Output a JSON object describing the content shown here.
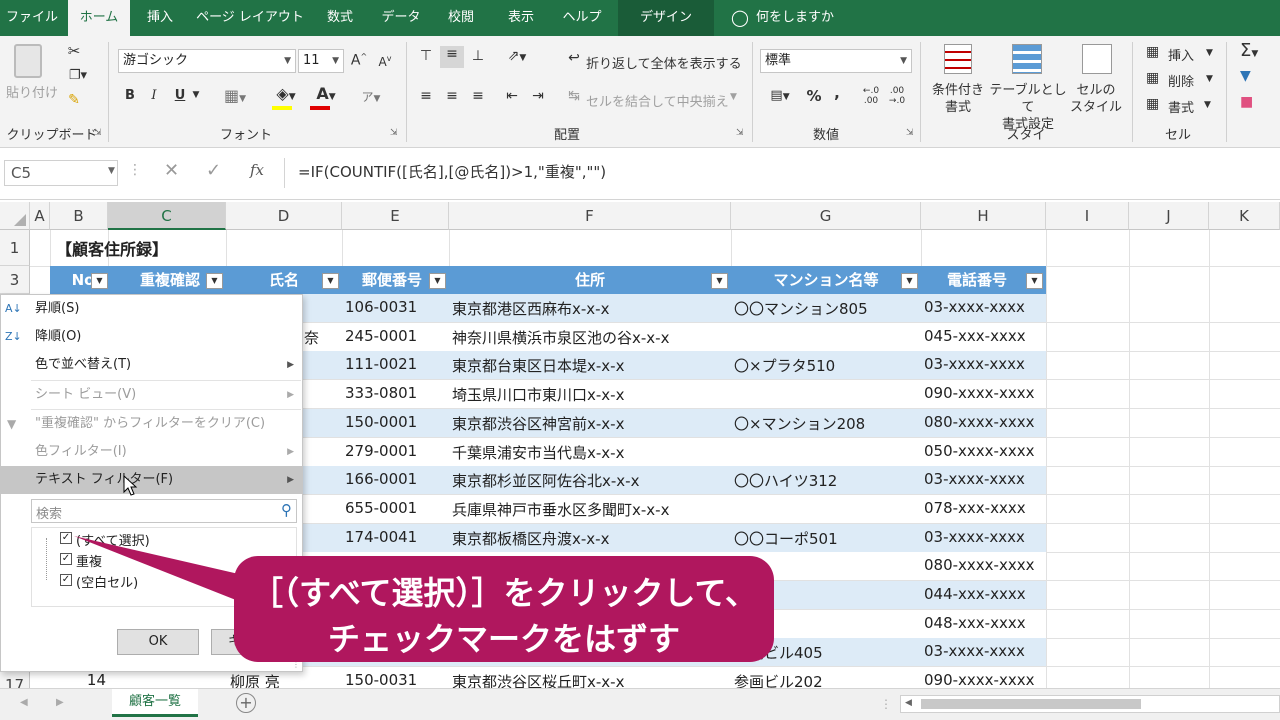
{
  "ribbon_tabs": [
    "ファイル",
    "ホーム",
    "挿入",
    "ページ レイアウト",
    "数式",
    "データ",
    "校閲",
    "表示",
    "ヘルプ",
    "デザイン",
    "何をしますか"
  ],
  "ribbon": {
    "paste": "貼り付け",
    "font_name": "游ゴシック",
    "font_size": "11",
    "bold": "B",
    "italic": "I",
    "underline": "U",
    "wrap_text": "折り返して全体を表示する",
    "merge_center": "セルを結合して中央揃え",
    "number_format": "標準",
    "conditional": "条件付き\n書式",
    "as_table": "テーブルとして\n書式設定",
    "cell_styles": "セルの\nスタイル",
    "insert": "挿入",
    "delete": "削除",
    "format": "書式",
    "groups": [
      "クリップボード",
      "フォント",
      "配置",
      "数値",
      "スタイル",
      "セル"
    ]
  },
  "formula_bar": {
    "name_box": "C5",
    "fx": "fx",
    "formula": "=IF(COUNTIF([氏名],[@氏名])>1,\"重複\",\"\")"
  },
  "columns": [
    "A",
    "B",
    "C",
    "D",
    "E",
    "F",
    "G",
    "H",
    "I",
    "J",
    "K"
  ],
  "row_numbers": [
    "1",
    "3",
    "17"
  ],
  "title_cell": "【顧客住所録】",
  "table_headers": [
    "No",
    "重複確認",
    "氏名",
    "郵便番号",
    "住所",
    "マンション名等",
    "電話番号"
  ],
  "rows": [
    {
      "zip": "106-0031",
      "addr": "東京都港区西麻布x-x-x",
      "bldg": "〇〇マンション805",
      "tel": "03-xxxx-xxxx"
    },
    {
      "zip": "245-0001",
      "addr": "神奈川県横浜市泉区池の谷x-x-x",
      "bldg": "",
      "tel": "045-xxx-xxxx",
      "name_frag": "奈"
    },
    {
      "zip": "111-0021",
      "addr": "東京都台東区日本堤x-x-x",
      "bldg": "〇×プラタ510",
      "tel": "03-xxxx-xxxx"
    },
    {
      "zip": "333-0801",
      "addr": "埼玉県川口市東川口x-x-x",
      "bldg": "",
      "tel": "090-xxxx-xxxx"
    },
    {
      "zip": "150-0001",
      "addr": "東京都渋谷区神宮前x-x-x",
      "bldg": "〇×マンション208",
      "tel": "080-xxxx-xxxx"
    },
    {
      "zip": "279-0001",
      "addr": "千葉県浦安市当代島x-x-x",
      "bldg": "",
      "tel": "050-xxxx-xxxx"
    },
    {
      "zip": "166-0001",
      "addr": "東京都杉並区阿佐谷北x-x-x",
      "bldg": "〇〇ハイツ312",
      "tel": "03-xxxx-xxxx"
    },
    {
      "zip": "655-0001",
      "addr": "兵庫県神戸市垂水区多聞町x-x-x",
      "bldg": "",
      "tel": "078-xxx-xxxx"
    },
    {
      "zip": "174-0041",
      "addr": "東京都板橋区舟渡x-x-x",
      "bldg": "〇〇コーポ501",
      "tel": "03-xxxx-xxxx"
    },
    {
      "zip": "",
      "addr": "",
      "bldg": "",
      "tel": "080-xxxx-xxxx"
    },
    {
      "zip": "",
      "addr": "",
      "bldg": "",
      "tel": "044-xxx-xxxx"
    },
    {
      "zip": "",
      "addr": "",
      "bldg": "",
      "tel": "048-xxx-xxxx"
    },
    {
      "zip": "",
      "addr": "",
      "bldg": "丸閣ビル405",
      "tel": "03-xxxx-xxxx"
    },
    {
      "zip": "150-0031",
      "addr": "東京都渋谷区桜丘町x-x-x",
      "bldg": "参画ビル202",
      "tel": "090-xxxx-xxxx",
      "no": "14",
      "name": "柳原 亮"
    }
  ],
  "filter_menu": {
    "sort_asc": "昇順(S)",
    "sort_desc": "降順(O)",
    "sort_color": "色で並べ替え(T)",
    "sheet_view": "シート ビュー(V)",
    "clear_filter": "\"重複確認\" からフィルターをクリア(C)",
    "color_filter": "色フィルター(I)",
    "text_filter": "テキスト フィルター(F)",
    "search_placeholder": "検索",
    "options": [
      "(すべて選択)",
      "重複",
      "(空白セル)"
    ],
    "ok": "OK",
    "cancel": "キャ"
  },
  "sheet_tab": "顧客一覧",
  "callout": {
    "line1": "［（すべて選択）］をクリックして、",
    "line2": "チェックマークをはずす"
  },
  "colors": {
    "excel_green": "#217346",
    "table_header": "#5b9bd5",
    "band_light": "#ddebf7",
    "callout": "#b0175e"
  }
}
